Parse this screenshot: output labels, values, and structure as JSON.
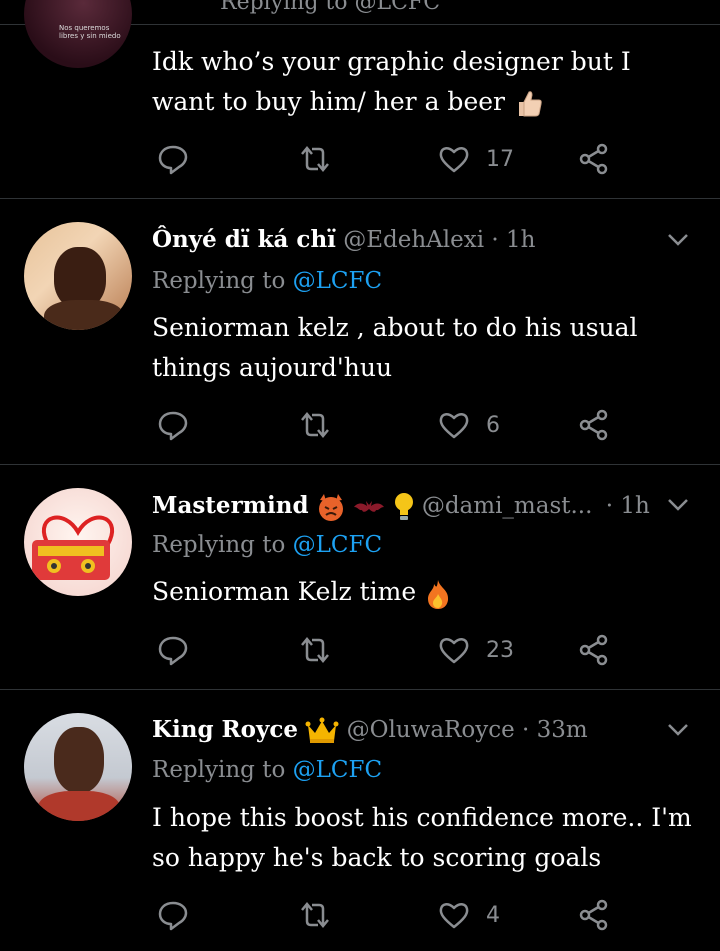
{
  "top_partial": {
    "reply_text": "Replying to @LCFC"
  },
  "tweets": [
    {
      "id": "tweet-0",
      "body": "Idk who’s your graphic designer but I want to buy him/ her a beer",
      "likes": "17"
    },
    {
      "id": "tweet-1",
      "name": "Ônyé dï ká chï",
      "handle": "@EdehAlexi",
      "time": "· 1h",
      "reply_prefix": "Replying to ",
      "reply_handle": "@LCFC",
      "body": "Seniorman kelz ,  about to do his usual things aujourd'huu",
      "likes": "6"
    },
    {
      "id": "tweet-2",
      "name": "Mastermind",
      "handle": "@dami_mast...",
      "time": "· 1h",
      "reply_prefix": "Replying to ",
      "reply_handle": "@LCFC",
      "body": "Seniorman Kelz time",
      "likes": "23"
    },
    {
      "id": "tweet-3",
      "name": "King Royce",
      "handle": "@OluwaRoyce",
      "time": "· 33m",
      "reply_prefix": "Replying to ",
      "reply_handle": "@LCFC",
      "body": "I hope this boost his confidence more.. I'm so happy he's back to scoring goals",
      "likes": "4"
    }
  ],
  "colors": {
    "background": "#000000",
    "text": "#ffffff",
    "muted": "#8a8d91",
    "link": "#1da1f2",
    "divider": "#2f3336"
  },
  "icons": [
    "reply-icon",
    "retweet-icon",
    "like-icon",
    "share-icon",
    "chevron-down-icon",
    "thumbs-up-emoji",
    "angry-devil-emoji",
    "bat-emoji",
    "light-bulb-emoji",
    "fire-emoji",
    "crown-emoji"
  ]
}
